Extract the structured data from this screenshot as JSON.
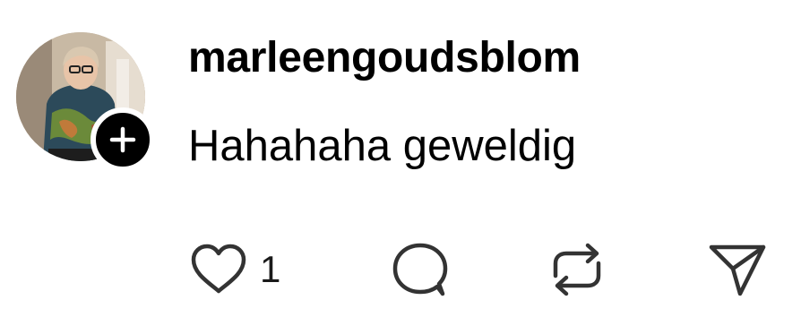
{
  "post": {
    "username": "marleengoudsblom",
    "text": "Hahahaha geweldig"
  },
  "avatar": {
    "icon": "profile-photo",
    "follow_icon": "plus-icon"
  },
  "actions": {
    "like_icon": "heart-icon",
    "like_count": "1",
    "reply_icon": "comment-icon",
    "repost_icon": "repost-icon",
    "share_icon": "send-icon"
  },
  "colors": {
    "text": "#000000",
    "icon_stroke": "#333333",
    "badge_bg": "#000000",
    "background": "#ffffff"
  }
}
